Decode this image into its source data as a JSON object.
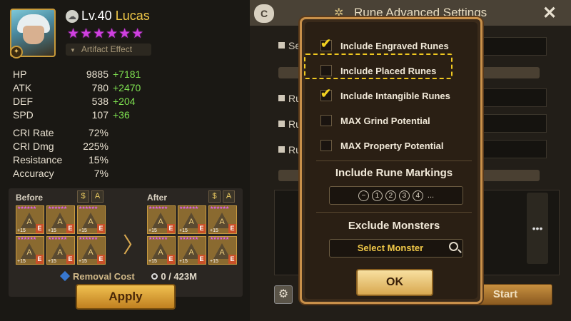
{
  "hero": {
    "level_label": "Lv.40",
    "name": "Lucas",
    "stars": "★★★★★★",
    "artifact_label": "Artifact Effect"
  },
  "stats": [
    {
      "label": "HP",
      "value": "9885",
      "bonus": "+7181"
    },
    {
      "label": "ATK",
      "value": "780",
      "bonus": "+2470"
    },
    {
      "label": "DEF",
      "value": "538",
      "bonus": "+204"
    },
    {
      "label": "SPD",
      "value": "107",
      "bonus": "+36"
    }
  ],
  "stats_secondary": [
    {
      "label": "CRI Rate",
      "value": "72%"
    },
    {
      "label": "CRI Dmg",
      "value": "225%"
    },
    {
      "label": "Resistance",
      "value": "15%"
    },
    {
      "label": "Accuracy",
      "value": "7%"
    }
  ],
  "runes": {
    "before_label": "Before",
    "after_label": "After",
    "icon_a": "A",
    "icon_b": "$",
    "rune_plus": "+15",
    "rune_grade": "E",
    "rune_glyph": "A",
    "removal_label": "Removal Cost",
    "removal_cost": "0 / 423M"
  },
  "apply_label": "Apply",
  "settings": {
    "title": "Rune Advanced Settings",
    "c_label": "C",
    "close": "✕",
    "bg_labels": [
      "Se",
      "Ru",
      "Ru",
      "Ru"
    ],
    "start_label": "Start",
    "dots": "•••"
  },
  "modal": {
    "options": [
      {
        "label": "Include Engraved Runes",
        "checked": true
      },
      {
        "label": "Include Placed Runes",
        "checked": false
      },
      {
        "label": "Include Intangible Runes",
        "checked": true
      },
      {
        "label": "MAX Grind Potential",
        "checked": false
      },
      {
        "label": "MAX Property Potential",
        "checked": false
      }
    ],
    "markings_title": "Include Rune Markings",
    "markings": [
      "−",
      "1",
      "2",
      "3",
      "4"
    ],
    "markings_more": "...",
    "exclude_title": "Exclude Monsters",
    "select_monster": "Select Monster",
    "ok_label": "OK"
  },
  "colors": {
    "accent_gold": "#f0c848",
    "bonus_green": "#7ee050",
    "star_purple": "#d040e0",
    "highlight": "#f0c820"
  }
}
